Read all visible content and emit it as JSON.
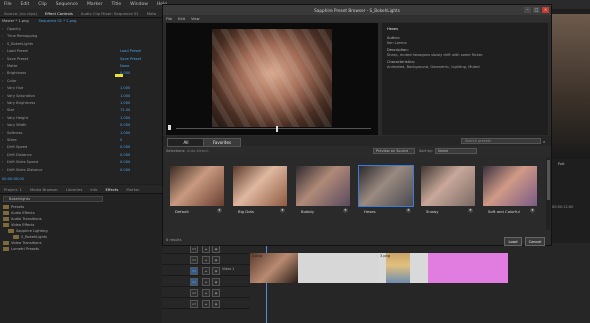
{
  "menubar": {
    "items": [
      "File",
      "Edit",
      "Clip",
      "Sequence",
      "Marker",
      "Title",
      "Window",
      "Help"
    ]
  },
  "effect_controls": {
    "tabs": [
      "Source: (no clips)",
      "Effect Controls",
      "Audio Clip Mixer: Sequence 01",
      "Meta"
    ],
    "source_label": "Master * 1.png",
    "sequence_label": "Sequence 01 * 1.png",
    "rows": [
      {
        "label": "Opacity",
        "value": ""
      },
      {
        "label": "Time Remapping",
        "value": ""
      },
      {
        "label": "S_BokehLights",
        "value": ""
      },
      {
        "label": "Load Preset",
        "value": "Load Preset"
      },
      {
        "label": "Save Preset",
        "value": "Save Preset"
      },
      {
        "label": "Matte",
        "value": "None"
      },
      {
        "label": "Brightness",
        "value": "0.000"
      },
      {
        "label": "Color",
        "value": ""
      },
      {
        "label": "Vary Hue",
        "value": "1.000"
      },
      {
        "label": "Vary Saturation",
        "value": "1.000"
      },
      {
        "label": "Vary Brightness",
        "value": "1.000"
      },
      {
        "label": "Size",
        "value": "72.00"
      },
      {
        "label": "Vary Height",
        "value": "1.000"
      },
      {
        "label": "Vary Width",
        "value": "0.000"
      },
      {
        "label": "Softness",
        "value": "1.000"
      },
      {
        "label": "Sides",
        "value": "0"
      },
      {
        "label": "Drift Speed",
        "value": "0.000"
      },
      {
        "label": "Drift Distance",
        "value": "0.000"
      },
      {
        "label": "Drift Sides Speed",
        "value": "0.000"
      },
      {
        "label": "Drift Sides Distance",
        "value": "0.000"
      }
    ],
    "timecode": "00:00:00:00"
  },
  "project_panel": {
    "tabs": [
      "Project: 1",
      "Media Browser",
      "Libraries",
      "Info",
      "Effects",
      "Marker"
    ],
    "search": "Bokehlights",
    "tree": [
      {
        "label": "Presets",
        "indent": 0
      },
      {
        "label": "Audio Effects",
        "indent": 0
      },
      {
        "label": "Audio Transitions",
        "indent": 0
      },
      {
        "label": "Video Effects",
        "indent": 0
      },
      {
        "label": "Sapphire Lighting",
        "indent": 1
      },
      {
        "label": "S_BokehLights",
        "indent": 2
      },
      {
        "label": "Video Transitions",
        "indent": 0
      },
      {
        "label": "Lumetri Presets",
        "indent": 0
      }
    ]
  },
  "dialog": {
    "title": "Sapphire Preset Browser - S_BokehLights",
    "menu": [
      "File",
      "Edit",
      "View"
    ],
    "info": {
      "name": "Hexes",
      "author_label": "Author:",
      "author": "Ken Lorenz",
      "description_label": "Description:",
      "description": "Sharp, muted hexagons slowly drift with some flicker.",
      "characteristics_label": "Characteristics:",
      "characteristics": "Animated, Background, Geometric, Lighting, Muted"
    },
    "tabs": {
      "all": "All",
      "favorites": "Favorites"
    },
    "search_placeholder": "Search presets",
    "filter": {
      "selections_label": "Selections:",
      "selections_value": "Auto-Detect",
      "preview_on": "Preview on Source",
      "sort_label": "Sort by:",
      "sort_value": "Name"
    },
    "presets": [
      {
        "name": "Default",
        "selected": false
      },
      {
        "name": "Big Dots",
        "selected": false
      },
      {
        "name": "Bubbly",
        "selected": false
      },
      {
        "name": "Hexes",
        "selected": true
      },
      {
        "name": "Snowy",
        "selected": false
      },
      {
        "name": "Soft and Colorful",
        "selected": false
      }
    ],
    "results": "6 results",
    "load_button": "Load",
    "cancel_button": "Cancel"
  },
  "timeline": {
    "tracks": [
      "V3",
      "V2",
      "V1",
      "A1",
      "A2",
      "A3"
    ],
    "clip_label": "1.png",
    "clip2_label": "3.png",
    "v1_label": "Video 1"
  },
  "right_panel": {
    "fit_label": "Full",
    "timecode": "00:00:12:00"
  }
}
